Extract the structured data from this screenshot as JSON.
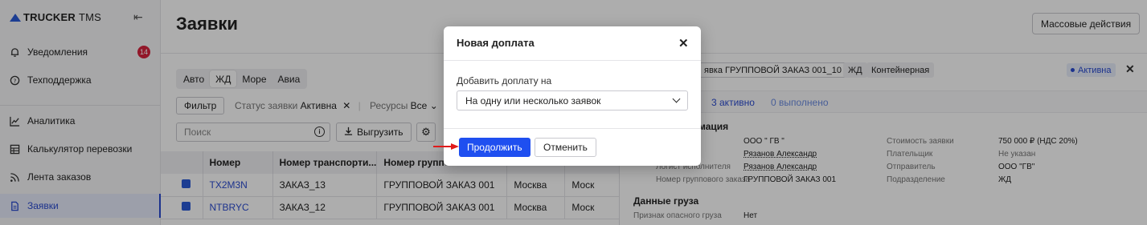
{
  "brand": {
    "name": "TRUCKER",
    "suffix": "TMS"
  },
  "sidebar": {
    "collapse_icon": "collapse-left-icon",
    "items": [
      {
        "label": "Уведомления",
        "icon": "bell-icon",
        "badge": "14"
      },
      {
        "label": "Техподдержка",
        "icon": "help-circle-icon"
      },
      {
        "label": "Аналитика",
        "icon": "chart-line-icon"
      },
      {
        "label": "Калькулятор перевозки",
        "icon": "table-icon"
      },
      {
        "label": "Лента заказов",
        "icon": "rss-icon"
      },
      {
        "label": "Заявки",
        "icon": "document-icon",
        "active": true
      }
    ]
  },
  "header": {
    "title": "Заявки",
    "mass_actions": "Массовые действия"
  },
  "tabs": [
    {
      "label": "Авто"
    },
    {
      "label": "ЖД",
      "selected": true
    },
    {
      "label": "Море"
    },
    {
      "label": "Авиа"
    }
  ],
  "filters": {
    "filter_button": "Фильтр",
    "status_label": "Статус заявки",
    "status_value": "Активна",
    "resources_label": "Ресурсы",
    "resources_value": "Все"
  },
  "search": {
    "placeholder": "Поиск"
  },
  "toolbar": {
    "export_label": "Выгрузить"
  },
  "table": {
    "columns": [
      "Номер",
      "Номер транспорти...",
      "Номер группово...",
      "",
      ""
    ],
    "rows": [
      {
        "number": "TX2M3N",
        "transport": "ЗАКАЗ_13",
        "group": "ГРУППОВОЙ ЗАКАЗ 001",
        "city1": "Москва",
        "city2": "Моск"
      },
      {
        "number": "NTBRYC",
        "transport": "ЗАКАЗ_12",
        "group": "ГРУППОВОЙ ЗАКАЗ 001",
        "city1": "Москва",
        "city2": "Моск"
      }
    ]
  },
  "panel": {
    "chips": [
      "явка ГРУППОВОЙ ЗАКАЗ 001_10",
      "ЖД",
      "Контейнерная"
    ],
    "status": "Активна",
    "counters": {
      "active": "3 активно",
      "done": "0 выполнено"
    },
    "section_info": "мация",
    "info_left_labels": [
      "Логист исполнителя",
      "Номер группового заказа"
    ],
    "info_left_values": [
      "ООО \" ГВ \"",
      "Рязанов Александр",
      "Рязанов Александр",
      "ГРУППОВОЙ ЗАКАЗ 001"
    ],
    "info_right_labels": [
      "Стоимость заявки",
      "Плательщик",
      "Отправитель",
      "Подразделение"
    ],
    "info_right_values": [
      "750 000 ₽ (НДС 20%)",
      "Не указан",
      "ООО \"ГВ\"",
      "ЖД"
    ],
    "cargo_title": "Данные груза",
    "cargo_label": "Признак опасного груза",
    "cargo_value": "Нет"
  },
  "modal": {
    "title": "Новая доплата",
    "field_label": "Добавить доплату на",
    "select_value": "На одну или несколько заявок",
    "continue_label": "Продолжить",
    "cancel_label": "Отменить"
  },
  "colors": {
    "accent": "#1f4ff0",
    "badge": "#d8233d",
    "annotation_arrow": "#e01b1b"
  }
}
